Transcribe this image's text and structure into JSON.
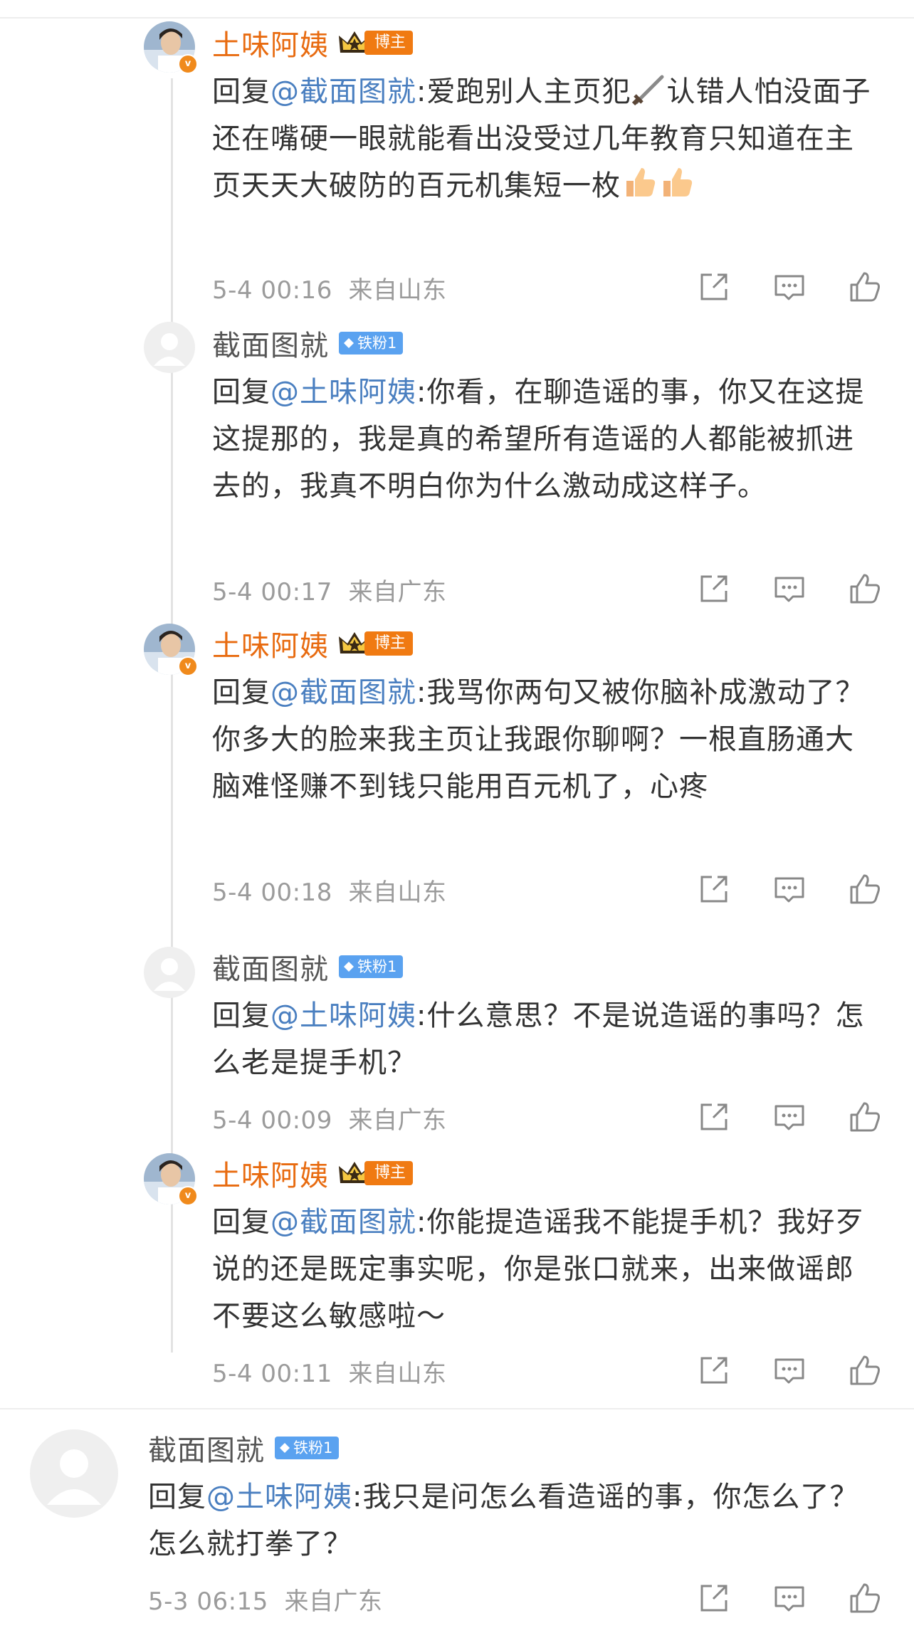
{
  "comments": [
    {
      "user": "土味阿姨",
      "badge": "博主",
      "reply_prefix": "回复",
      "mention": "@截面图就",
      "text": ":爱跑别人主页犯",
      "text_after_icon": "认错人怕没面子还在嘴硬一眼就能看出没受过几年教育只知道在主页天天大破防的百元机集短一枚",
      "time": "5-4 00:16",
      "location": "来自山东"
    },
    {
      "user": "截面图就",
      "badge": "铁粉1",
      "reply_prefix": "回复",
      "mention": "@土味阿姨",
      "text": ":你看，在聊造谣的事，你又在这提这提那的，我是真的希望所有造谣的人都能被抓进去的，我真不明白你为什么激动成这样子。",
      "time": "5-4 00:17",
      "location": "来自广东"
    },
    {
      "user": "土味阿姨",
      "badge": "博主",
      "reply_prefix": "回复",
      "mention": "@截面图就",
      "text": ":我骂你两句又被你脑补成激动了？你多大的脸来我主页让我跟你聊啊？一根直肠通大脑难怪赚不到钱只能用百元机了，心疼",
      "time": "5-4 00:18",
      "location": "来自山东"
    },
    {
      "user": "截面图就",
      "badge": "铁粉1",
      "reply_prefix": "回复",
      "mention": "@土味阿姨",
      "text": ":什么意思？不是说造谣的事吗？怎么老是提手机？",
      "time": "5-4 00:09",
      "location": "来自广东"
    },
    {
      "user": "土味阿姨",
      "badge": "博主",
      "reply_prefix": "回复",
      "mention": "@截面图就",
      "text": ":你能提造谣我不能提手机？我好歹说的还是既定事实呢，你是张口就来，出来做谣郎不要这么敏感啦～",
      "time": "5-4 00:11",
      "location": "来自山东"
    },
    {
      "user": "截面图就",
      "badge": "铁粉1",
      "reply_prefix": "回复",
      "mention": "@土味阿姨",
      "text": ":我只是问怎么看造谣的事，你怎么了？怎么就打拳了？",
      "time": "5-3 06:15",
      "location": "来自广东"
    }
  ],
  "colors": {
    "blogger_name": "#e86b10",
    "mention": "#4a7fc0",
    "blogger_badge": "#f07a12",
    "fan_badge": "#5aa2f0",
    "meta": "#9b9b9b"
  },
  "icons": [
    "repost-icon",
    "comment-icon",
    "like-icon",
    "sword-icon",
    "thumbs-up-icon",
    "crown-icon",
    "diamond-icon"
  ]
}
